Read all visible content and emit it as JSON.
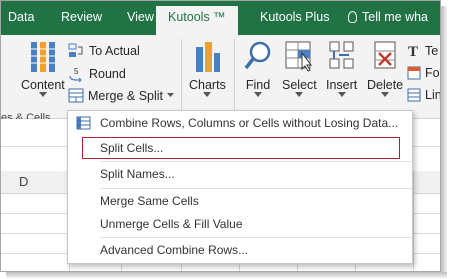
{
  "tabs": [
    "Data",
    "Review",
    "View",
    "Kutools ™",
    "Kutools Plus"
  ],
  "tell_me": "Tell me wha",
  "ribbon": {
    "content_label": "Content",
    "to_actual_label": "To Actual",
    "round_label": "Round",
    "merge_split_label": "Merge & Split",
    "charts_label": "Charts",
    "find_label": "Find",
    "select_label": "Select",
    "insert_label": "Insert",
    "delete_label": "Delete",
    "text_label": "Te",
    "format_label": "Fo",
    "link_label": "Lin",
    "group_label": "es & Cells"
  },
  "column_header": "D",
  "menu": {
    "items": [
      "Combine Rows, Columns or Cells without Losing Data...",
      "Split Cells...",
      "Split Names...",
      "Merge Same Cells",
      "Unmerge Cells & Fill Value",
      "Advanced Combine Rows..."
    ]
  },
  "colors": {
    "excel_green": "#217346",
    "highlight_border": "#a5272c",
    "ribbon_bg": "#f3f3f3"
  }
}
